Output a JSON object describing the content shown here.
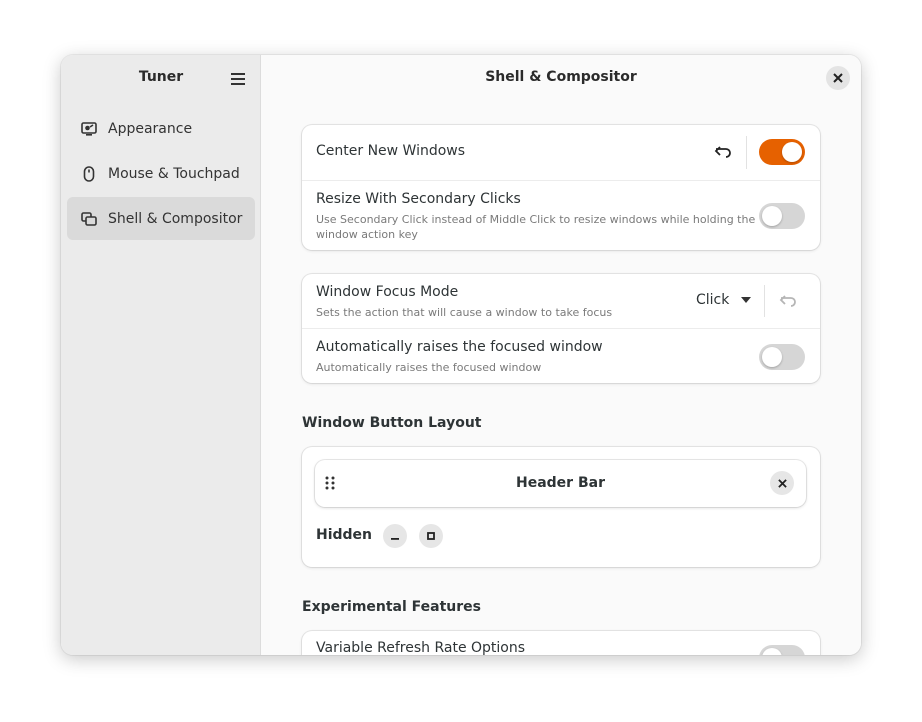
{
  "sidebar": {
    "title": "Tuner",
    "items": [
      {
        "label": "Appearance",
        "icon": "appearance-icon"
      },
      {
        "label": "Mouse & Touchpad",
        "icon": "mouse-icon"
      },
      {
        "label": "Shell & Compositor",
        "icon": "windows-icon",
        "active": true
      }
    ]
  },
  "main": {
    "title": "Shell & Compositor",
    "group1": {
      "center_new_windows": {
        "title": "Center New Windows",
        "enabled": true
      },
      "resize_secondary": {
        "title": "Resize With Secondary Clicks",
        "subtitle": "Use Secondary Click instead of Middle Click to resize windows while holding the window action key",
        "enabled": false
      }
    },
    "group2": {
      "focus_mode": {
        "title": "Window Focus Mode",
        "subtitle": "Sets the action that will cause a window to take focus",
        "value": "Click"
      },
      "auto_raise": {
        "title": "Automatically raises the focused window",
        "subtitle": "Automatically raises the focused window",
        "enabled": false
      }
    },
    "button_layout": {
      "section_title": "Window Button Layout",
      "header_bar_label": "Header Bar",
      "hidden_label": "Hidden"
    },
    "experimental": {
      "section_title": "Experimental Features",
      "vrr": {
        "title": "Variable Refresh Rate Options",
        "enabled": false
      }
    }
  },
  "colors": {
    "accent": "#e66100",
    "sidebar_bg": "#ebebeb",
    "window_bg": "#fafafa"
  }
}
